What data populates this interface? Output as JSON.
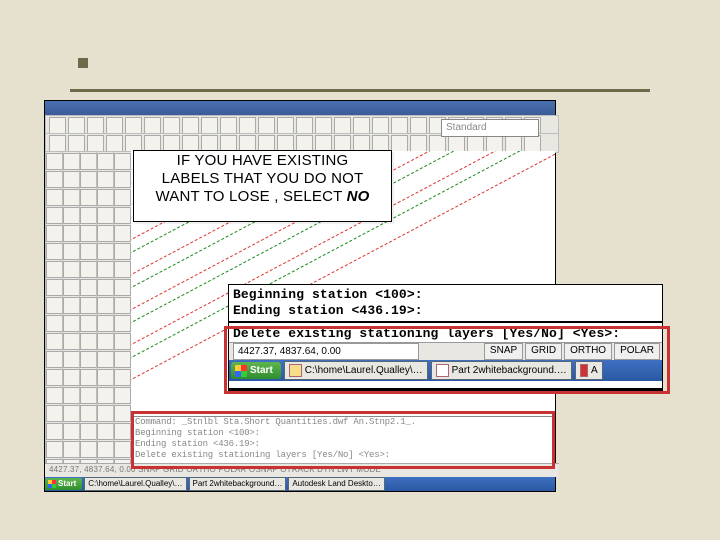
{
  "callout": {
    "line1": "IF YOU HAVE EXISTING",
    "line2": "LABELS THAT YOU DO NOT",
    "line3_a": "WANT TO LOSE , SELECT ",
    "line3_b": "NO"
  },
  "style_dropdown": "Standard",
  "command_window": {
    "l1": "Beginning station <100>:",
    "l2": "Ending station <436.19>:",
    "l3": "Delete existing stationing layers [Yes/No] <Yes>:"
  },
  "status": {
    "coords": "4427.37, 4837.64, 0.00",
    "b1": "SNAP",
    "b2": "GRID",
    "b3": "ORTHO",
    "b4": "POLAR"
  },
  "taskbar": {
    "start": "Start",
    "t1": "C:\\home\\Laurel.Qualley\\…",
    "t2": "Part 2whitebackground.…",
    "t3": "A"
  },
  "mini_cmd": {
    "m0": "Command: _Stnlbl    Sta.Short  Quantities.dwf  An.Stnp2.1_. ",
    "m1": "Beginning station <100>:",
    "m2": "Ending station <436.19>:",
    "m3": "Delete existing stationing layers [Yes/No] <Yes>:"
  },
  "bottom_status": "4427.37, 4837.64, 0.00    SNAP  GRID  ORTHO  POLAR  OSNAP  OTRACK  DYN  LWT  MODE",
  "bottom_task": {
    "start": "Start",
    "b1": "C:\\home\\Laurel.Qualley\\…",
    "b2": "Part 2whitebackground…",
    "b3": "Autodesk Land Deskto…"
  }
}
